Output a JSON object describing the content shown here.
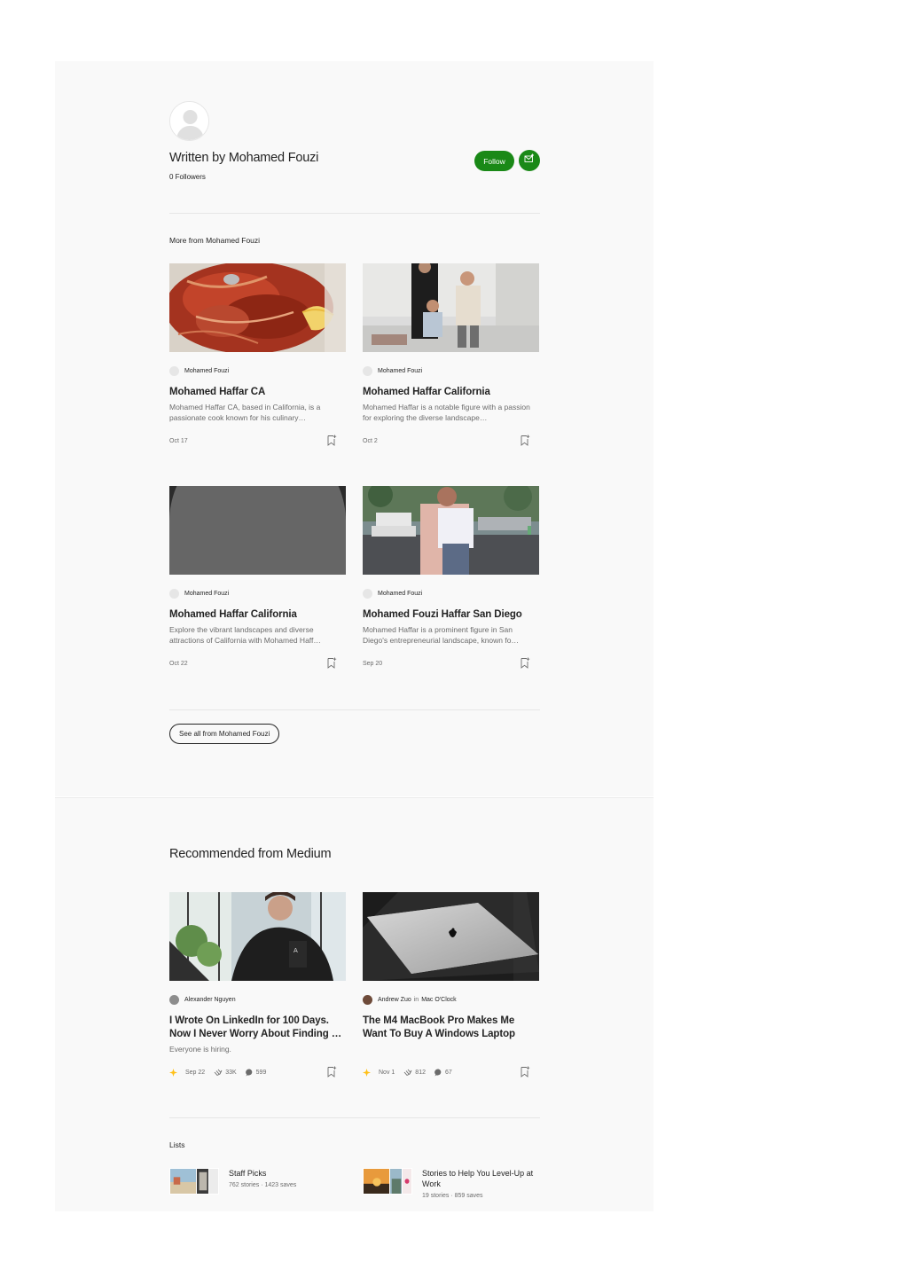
{
  "author": {
    "written_by": "Written by Mohamed Fouzi",
    "followers": "0 Followers",
    "follow_label": "Follow"
  },
  "more_from": {
    "heading": "More from Mohamed Fouzi",
    "see_all_label": "See all from Mohamed Fouzi",
    "cards": [
      {
        "author": "Mohamed Fouzi",
        "title": "Mohamed Haffar CA",
        "subtitle": "Mohamed Haffar CA, based in California, is a passionate cook known for his culinary…",
        "date": "Oct 17"
      },
      {
        "author": "Mohamed Fouzi",
        "title": "Mohamed Haffar California",
        "subtitle": "Mohamed Haffar is a notable figure with a passion for exploring the diverse landscape…",
        "date": "Oct 2"
      },
      {
        "author": "Mohamed Fouzi",
        "title": "Mohamed Haffar California",
        "subtitle": "Explore the vibrant landscapes and diverse attractions of California with Mohamed Haff…",
        "date": "Oct 22"
      },
      {
        "author": "Mohamed Fouzi",
        "title": "Mohamed Fouzi Haffar San Diego",
        "subtitle": "Mohamed Haffar is a prominent figure in San Diego's entrepreneurial landscape, known fo…",
        "date": "Sep 20"
      }
    ]
  },
  "recommended": {
    "heading": "Recommended from Medium",
    "cards": [
      {
        "author": "Alexander Nguyen",
        "publication": "",
        "title": "I Wrote On LinkedIn for 100 Days. Now I Never Worry About Finding …",
        "subtitle": "Everyone is hiring.",
        "date": "Sep 22",
        "claps": "33K",
        "responses": "599"
      },
      {
        "author": "Andrew Zuo",
        "in_label": "in",
        "publication": "Mac O'Clock",
        "title": "The M4 MacBook Pro Makes Me Want To Buy A Windows Laptop",
        "subtitle": "",
        "date": "Nov 1",
        "claps": "812",
        "responses": "67"
      }
    ]
  },
  "lists": {
    "heading": "Lists",
    "items": [
      {
        "title": "Staff Picks",
        "stories": "762 stories",
        "saves": "1423 saves"
      },
      {
        "title": "Stories to Help You Level-Up at Work",
        "stories": "19 stories",
        "saves": "859 saves"
      }
    ]
  },
  "colors": {
    "accent": "#1a8917",
    "member_star": "#ffc017",
    "text_primary": "#242424",
    "text_secondary": "#6b6b6b",
    "panel_bg": "#f9f9f9"
  },
  "icons": [
    "avatar-placeholder-icon",
    "subscribe-mail-icon",
    "bookmark-icon",
    "clap-icon",
    "response-icon",
    "member-star-icon"
  ]
}
